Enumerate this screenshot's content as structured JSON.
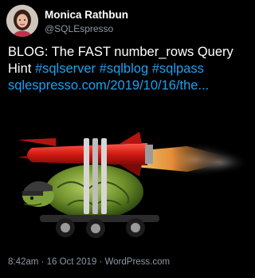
{
  "author": {
    "name": "Monica Rathbun",
    "handle": "@SQLEspresso"
  },
  "tweet": {
    "text": "BLOG: The FAST number_rows Query Hint",
    "hashtags": [
      "#sqlserver",
      "#sqlblog",
      "#sqlpass"
    ],
    "link": "sqlespresso.com/2019/10/16/the..."
  },
  "media": {
    "image_description_icon": "turtle-rocket-image"
  },
  "footer": {
    "time": "8:42am",
    "separator1": "·",
    "date": "16 Oct 2019",
    "separator2": "·",
    "source": "WordPress.com"
  },
  "colors": {
    "background": "#000000",
    "text": "#ffffff",
    "secondary": "#8b98a5",
    "link": "#1da1f2"
  }
}
